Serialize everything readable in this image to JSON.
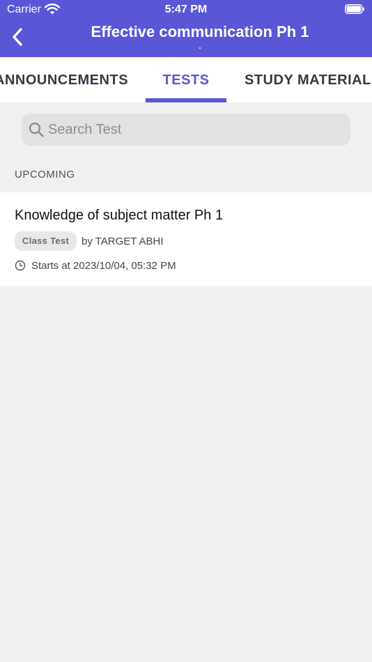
{
  "status_bar": {
    "carrier": "Carrier",
    "time": "5:47 PM",
    "wifi_icon": "wifi-icon",
    "battery_icon": "battery-icon"
  },
  "nav": {
    "title": "Effective communication Ph 1",
    "back_icon": "chevron-left-icon"
  },
  "tabs": [
    {
      "label": "ANNOUNCEMENTS",
      "active": false
    },
    {
      "label": "TESTS",
      "active": true
    },
    {
      "label": "STUDY MATERIAL",
      "active": false
    }
  ],
  "search": {
    "placeholder": "Search Test",
    "value": "",
    "icon": "search-icon"
  },
  "sections": [
    {
      "header": "UPCOMING",
      "items": [
        {
          "title": "Knowledge of subject matter Ph 1",
          "badge": "Class Test",
          "author": "by TARGET ABHI",
          "starts": "Starts at 2023/10/04, 05:32 PM",
          "time_icon": "clock-icon"
        }
      ]
    }
  ],
  "colors": {
    "accent": "#5a57d6",
    "background": "#f0f0f0",
    "card": "#ffffff"
  }
}
